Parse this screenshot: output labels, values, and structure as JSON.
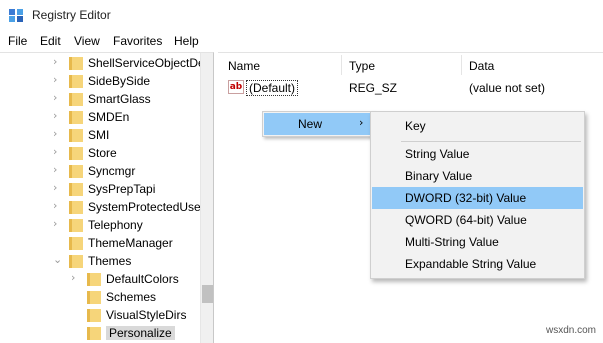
{
  "window": {
    "title": "Registry Editor"
  },
  "menubar": [
    "File",
    "Edit",
    "View",
    "Favorites",
    "Help"
  ],
  "tree": {
    "items": [
      {
        "label": "ShellServiceObjectDe",
        "expandable": true,
        "selected": false,
        "level": 1
      },
      {
        "label": "SideBySide",
        "expandable": true,
        "selected": false,
        "level": 1
      },
      {
        "label": "SmartGlass",
        "expandable": true,
        "selected": false,
        "level": 1
      },
      {
        "label": "SMDEn",
        "expandable": true,
        "selected": false,
        "level": 1
      },
      {
        "label": "SMI",
        "expandable": true,
        "selected": false,
        "level": 1
      },
      {
        "label": "Store",
        "expandable": true,
        "selected": false,
        "level": 1
      },
      {
        "label": "Syncmgr",
        "expandable": true,
        "selected": false,
        "level": 1
      },
      {
        "label": "SysPrepTapi",
        "expandable": true,
        "selected": false,
        "level": 1
      },
      {
        "label": "SystemProtectedUser",
        "expandable": true,
        "selected": false,
        "level": 1
      },
      {
        "label": "Telephony",
        "expandable": true,
        "selected": false,
        "level": 1
      },
      {
        "label": "ThemeManager",
        "expandable": false,
        "selected": false,
        "level": 1
      },
      {
        "label": "Themes",
        "expandable": true,
        "expanded": true,
        "selected": false,
        "level": 1
      },
      {
        "label": "DefaultColors",
        "expandable": true,
        "selected": false,
        "level": 2
      },
      {
        "label": "Schemes",
        "expandable": false,
        "selected": false,
        "level": 2
      },
      {
        "label": "VisualStyleDirs",
        "expandable": false,
        "selected": false,
        "level": 2
      },
      {
        "label": "Personalize",
        "expandable": false,
        "selected": true,
        "level": 2
      }
    ]
  },
  "list": {
    "headers": {
      "name": "Name",
      "type": "Type",
      "data": "Data"
    },
    "rows": [
      {
        "icon": "ab",
        "name": "(Default)",
        "type": "REG_SZ",
        "data": "(value not set)"
      }
    ]
  },
  "context_menu": {
    "new_label": "New",
    "arrow": "›"
  },
  "submenu": {
    "items": [
      {
        "label": "Key",
        "highlighted": false
      },
      {
        "label": "String Value",
        "highlighted": false
      },
      {
        "label": "Binary Value",
        "highlighted": false
      },
      {
        "label": "DWORD (32-bit) Value",
        "highlighted": true
      },
      {
        "label": "QWORD (64-bit) Value",
        "highlighted": false
      },
      {
        "label": "Multi-String Value",
        "highlighted": false
      },
      {
        "label": "Expandable String Value",
        "highlighted": false
      }
    ]
  },
  "watermark": "wsxdn.com",
  "colors": {
    "highlight": "#91c9f7",
    "folder": "#f6d57a",
    "folder_tab": "#e7b94c"
  }
}
